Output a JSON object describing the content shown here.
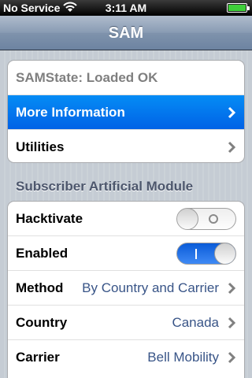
{
  "status_bar": {
    "carrier": "No Service",
    "time": "3:11 AM"
  },
  "nav": {
    "title": "SAM"
  },
  "group1": {
    "state": "SAMState: Loaded OK",
    "more_info": "More Information",
    "utilities": "Utilities"
  },
  "section": {
    "header": "Subscriber Artificial Module"
  },
  "settings": {
    "hacktivate": {
      "label": "Hacktivate",
      "on": false
    },
    "enabled": {
      "label": "Enabled",
      "on": true
    },
    "method": {
      "label": "Method",
      "value": "By Country and Carrier"
    },
    "country": {
      "label": "Country",
      "value": "Canada"
    },
    "carrier": {
      "label": "Carrier",
      "value": "Bell Mobility"
    }
  },
  "colors": {
    "selected": "#0162e6",
    "value_text": "#385487",
    "toggle_on": "#0a5bd8"
  }
}
